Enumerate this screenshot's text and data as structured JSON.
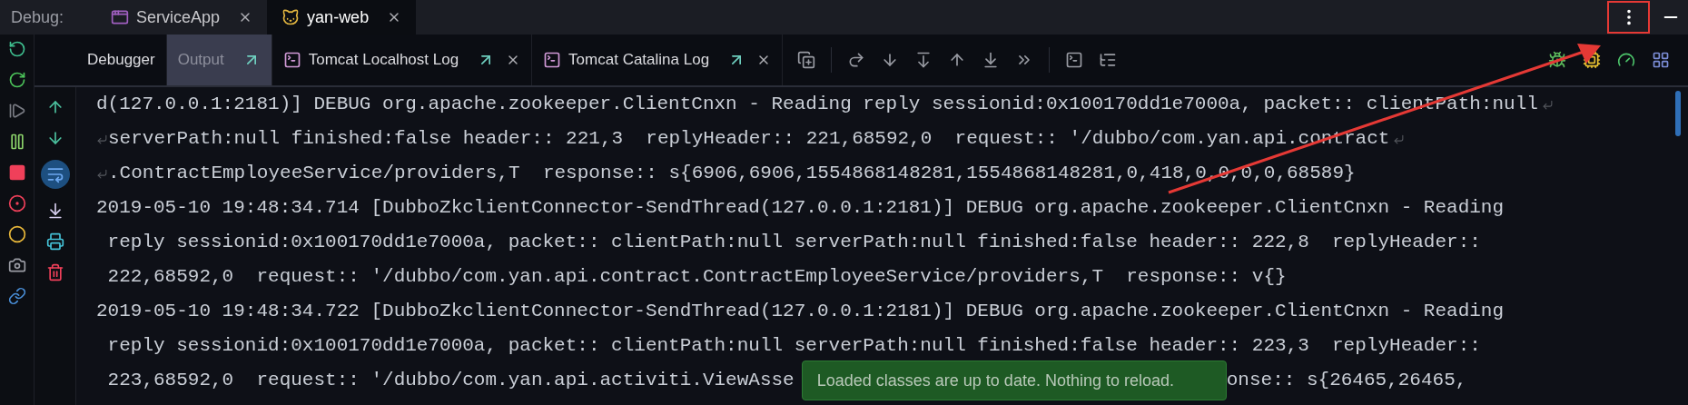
{
  "debug_label": "Debug:",
  "run_tabs": [
    {
      "label": "ServiceApp",
      "selected": false,
      "kind": "app"
    },
    {
      "label": "yan-web",
      "selected": true,
      "kind": "tomcat"
    }
  ],
  "tool_tabs": [
    {
      "label": "Debugger",
      "selected": false,
      "kind": "plain"
    },
    {
      "label": "Output",
      "selected": true,
      "kind": "output"
    },
    {
      "label": "Tomcat Localhost Log",
      "selected": false,
      "kind": "log"
    },
    {
      "label": "Tomcat Catalina Log",
      "selected": false,
      "kind": "log"
    }
  ],
  "soft_wrap": {
    "on": true
  },
  "log_lines": [
    {
      "text": "d(127.0.0.1:2181)] DEBUG org.apache.zookeeper.ClientCnxn - Reading reply sessionid:0x100170dd1e7000a, packet:: clientPath:null",
      "wrap_start": false,
      "wrap_end": true
    },
    {
      "text": "serverPath:null finished:false header:: 221,3  replyHeader:: 221,68592,0  request:: '/dubbo/com.yan.api.contract",
      "wrap_start": true,
      "wrap_end": true
    },
    {
      "text": ".ContractEmployeeService/providers,T  response:: s{6906,6906,1554868148281,1554868148281,0,418,0,0,0,0,68589}",
      "wrap_start": true,
      "wrap_end": false
    },
    {
      "text": "2019-05-10 19:48:34.714 [DubboZkclientConnector-SendThread(127.0.0.1:2181)] DEBUG org.apache.zookeeper.ClientCnxn - Reading",
      "wrap_start": false,
      "wrap_end": false
    },
    {
      "text": " reply sessionid:0x100170dd1e7000a, packet:: clientPath:null serverPath:null finished:false header:: 222,8  replyHeader::",
      "wrap_start": false,
      "wrap_end": false
    },
    {
      "text": " 222,68592,0  request:: '/dubbo/com.yan.api.contract.ContractEmployeeService/providers,T  response:: v{}",
      "wrap_start": false,
      "wrap_end": false
    },
    {
      "text": "2019-05-10 19:48:34.722 [DubboZkclientConnector-SendThread(127.0.0.1:2181)] DEBUG org.apache.zookeeper.ClientCnxn - Reading",
      "wrap_start": false,
      "wrap_end": false
    },
    {
      "text": " reply sessionid:0x100170dd1e7000a, packet:: clientPath:null serverPath:null finished:false header:: 223,3  replyHeader::",
      "wrap_start": false,
      "wrap_end": false
    },
    {
      "text": " 223,68592,0  request:: '/dubbo/com.yan.api.activiti.ViewAsse",
      "text_after": "onse:: s{26465,26465,",
      "wrap_start": false,
      "wrap_end": false
    }
  ],
  "toast": {
    "text": "Loaded classes are up to date. Nothing to reload."
  }
}
